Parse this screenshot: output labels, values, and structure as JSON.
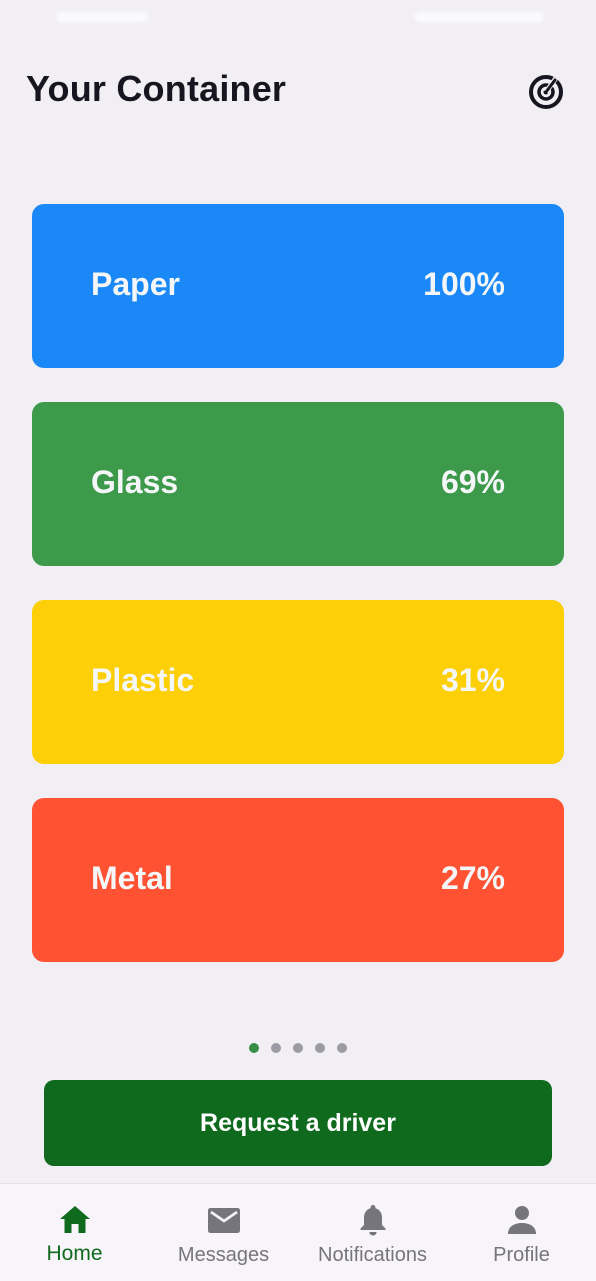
{
  "header": {
    "title": "Your Container",
    "icon": "radar-icon"
  },
  "containers": [
    {
      "label": "Paper",
      "value": "100%",
      "fill_percent": 100,
      "color": "#1a88f6"
    },
    {
      "label": "Glass",
      "value": "69%",
      "fill_percent": 69,
      "color": "#3d9a4b"
    },
    {
      "label": "Plastic",
      "value": "31%",
      "fill_percent": 31,
      "color": "#fdcf07"
    },
    {
      "label": "Metal",
      "value": "27%",
      "fill_percent": 27,
      "color": "#ff5233"
    }
  ],
  "pager": {
    "count": 5,
    "active_index": 0,
    "active_color": "#3a8d45"
  },
  "action": {
    "request_label": "Request a driver",
    "color": "#0f6a1e"
  },
  "nav": {
    "active_color": "#106a1e",
    "items": [
      {
        "label": "Home",
        "icon": "home-icon",
        "active": true
      },
      {
        "label": "Messages",
        "icon": "mail-icon",
        "active": false
      },
      {
        "label": "Notifications",
        "icon": "bell-icon",
        "active": false
      },
      {
        "label": "Profile",
        "icon": "person-icon",
        "active": false
      }
    ]
  }
}
